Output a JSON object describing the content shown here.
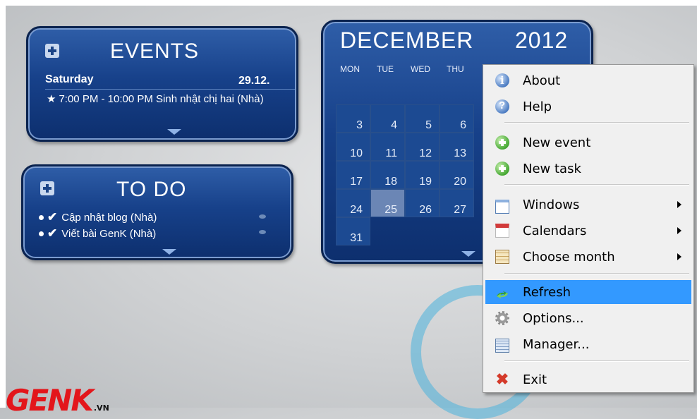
{
  "events": {
    "title": "EVENTS",
    "day": "Saturday",
    "date": "29.12.",
    "entry": "7:00 PM - 10:00 PM Sinh nhật chị hai (Nhà)"
  },
  "todo": {
    "title": "TO DO",
    "items": [
      "Cập nhật blog (Nhà)",
      "Viết bài GenK (Nhà)"
    ]
  },
  "calendar": {
    "month": "DECEMBER",
    "year": "2012",
    "weekdays": [
      "MON",
      "TUE",
      "WED",
      "THU"
    ],
    "rows": [
      [
        "3",
        "4",
        "5",
        "6"
      ],
      [
        "10",
        "11",
        "12",
        "13"
      ],
      [
        "17",
        "18",
        "19",
        "20"
      ],
      [
        "24",
        "25",
        "26",
        "27"
      ],
      [
        "31"
      ]
    ],
    "today": "25"
  },
  "menu": {
    "items": [
      {
        "label": "About",
        "icon": "info-icon"
      },
      {
        "label": "Help",
        "icon": "help-icon"
      },
      {
        "label": "New event",
        "icon": "add-event-icon"
      },
      {
        "label": "New task",
        "icon": "add-task-icon"
      },
      {
        "label": "Windows",
        "icon": "window-icon"
      },
      {
        "label": "Calendars",
        "icon": "calendar-icon"
      },
      {
        "label": "Choose month",
        "icon": "month-grid-icon"
      },
      {
        "label": "Refresh",
        "icon": "refresh-icon"
      },
      {
        "label": "Options...",
        "icon": "gear-icon"
      },
      {
        "label": "Manager...",
        "icon": "manager-icon"
      },
      {
        "label": "Exit",
        "icon": "exit-icon"
      }
    ],
    "highlighted": "Refresh"
  },
  "watermark": {
    "brand": "GENK",
    "suffix": ".VN"
  },
  "colors": {
    "widget_blue": "#17418a",
    "highlight": "#3399ff",
    "logo_red": "#e3161b"
  }
}
